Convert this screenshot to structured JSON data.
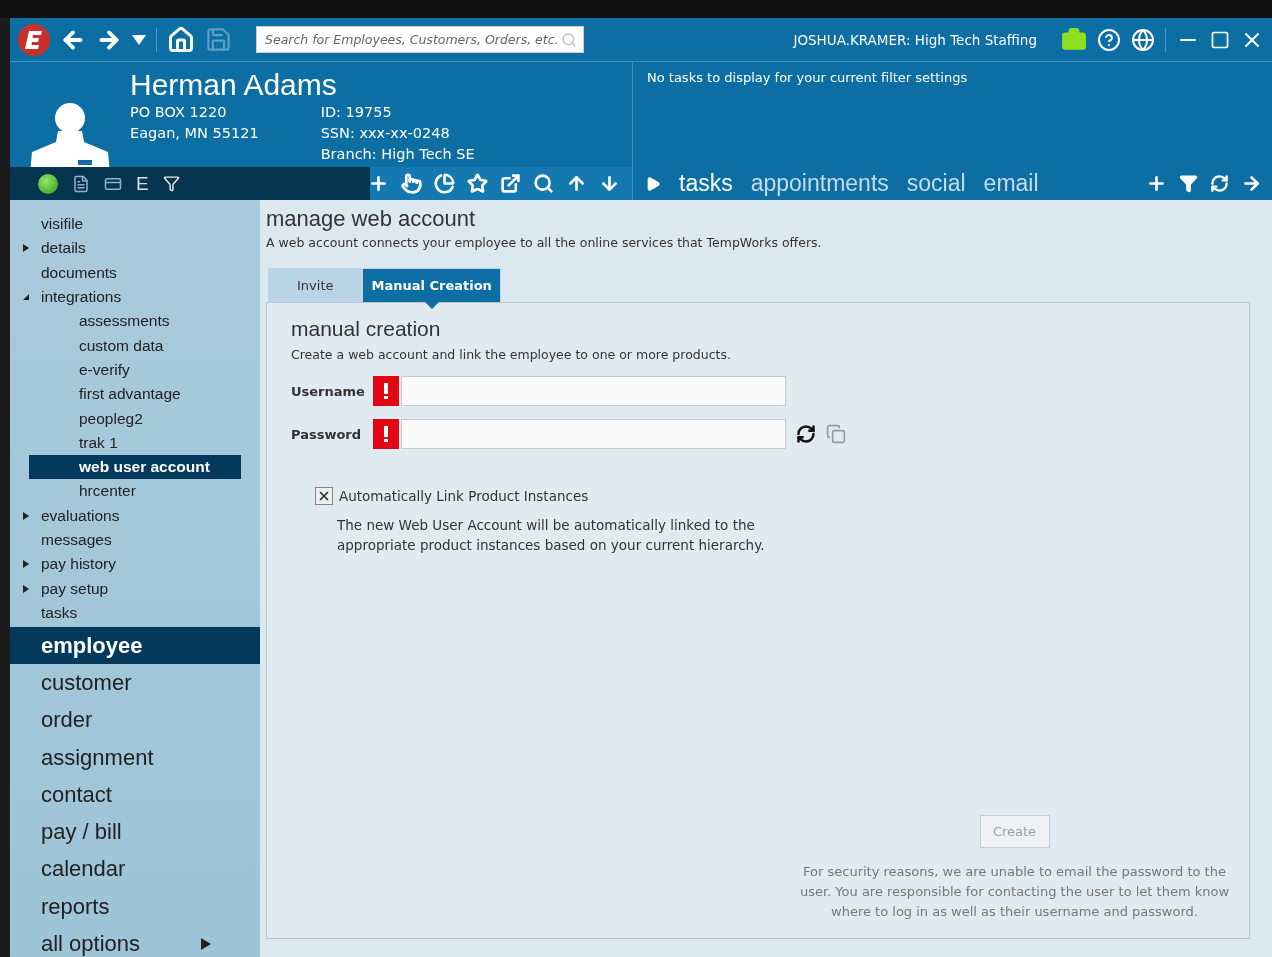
{
  "title_bar": {
    "search": {
      "placeholder": "Search for Employees, Customers, Orders, etc."
    },
    "user": "JOSHUA.KRAMER: High Tech Staffing"
  },
  "record": {
    "name": "Herman Adams",
    "address": [
      "PO BOX 1220",
      "Eagan, MN 55121"
    ],
    "fields": [
      {
        "label": "ID:",
        "value": "19755"
      },
      {
        "label": "SSN:",
        "value": "xxx-xx-0248"
      },
      {
        "label": "Branch:",
        "value": "High Tech SE"
      }
    ],
    "status_letter": "E"
  },
  "tasks_panel": {
    "message": "No tasks to display for your current filter settings",
    "tabs": [
      {
        "label": "tasks",
        "selected": true
      },
      {
        "label": "appointments",
        "selected": false
      },
      {
        "label": "social",
        "selected": false
      },
      {
        "label": "email",
        "selected": false
      }
    ]
  },
  "sidebar": {
    "tree": [
      {
        "label": "visifile",
        "selected": false
      },
      {
        "label": "details",
        "selected": false,
        "expanded": false
      },
      {
        "label": "documents",
        "selected": false
      },
      {
        "label": "integrations",
        "selected": false,
        "expanded": true,
        "children": [
          {
            "label": "assessments",
            "selected": false
          },
          {
            "label": "custom data",
            "selected": false
          },
          {
            "label": "e-verify",
            "selected": false
          },
          {
            "label": "first advantage",
            "selected": false
          },
          {
            "label": "peopleg2",
            "selected": false
          },
          {
            "label": "trak 1",
            "selected": false
          },
          {
            "label": "web user account",
            "selected": true
          },
          {
            "label": "hrcenter",
            "selected": false
          }
        ]
      },
      {
        "label": "evaluations",
        "selected": false,
        "expanded": false
      },
      {
        "label": "messages",
        "selected": false
      },
      {
        "label": "pay history",
        "selected": false,
        "expanded": false
      },
      {
        "label": "pay setup",
        "selected": false,
        "expanded": false
      },
      {
        "label": "tasks",
        "selected": false
      }
    ],
    "nav": [
      {
        "label": "employee",
        "selected": true
      },
      {
        "label": "customer",
        "selected": false
      },
      {
        "label": "order",
        "selected": false
      },
      {
        "label": "assignment",
        "selected": false
      },
      {
        "label": "contact",
        "selected": false
      },
      {
        "label": "pay / bill",
        "selected": false
      },
      {
        "label": "calendar",
        "selected": false
      },
      {
        "label": "reports",
        "selected": false
      },
      {
        "label": "all options",
        "selected": false,
        "submenu": true
      }
    ]
  },
  "content": {
    "title": "manage web account",
    "subtitle": "A web account connects your employee to all the online services that TempWorks offers.",
    "tabs": [
      {
        "label": "Invite",
        "selected": false
      },
      {
        "label": "Manual Creation",
        "selected": true
      }
    ],
    "section_title": "manual creation",
    "section_subtitle": "Create a web account and link the employee to one or more products.",
    "fields": [
      {
        "label": "Username",
        "required": true,
        "kind": "text"
      },
      {
        "label": "Password",
        "required": true,
        "kind": "password"
      }
    ],
    "auto_link": {
      "label": "Automatically Link Product Instances",
      "checked": true,
      "note": "The new Web User Account will be automatically linked to the appropriate product instances based on your current hierarchy."
    },
    "create_button": {
      "label": "Create",
      "disabled": true
    },
    "security_note": "For security reasons, we are unable to email the password to the user.  You are responsible for contacting the user to let them know where to log in as well as their username and password."
  }
}
